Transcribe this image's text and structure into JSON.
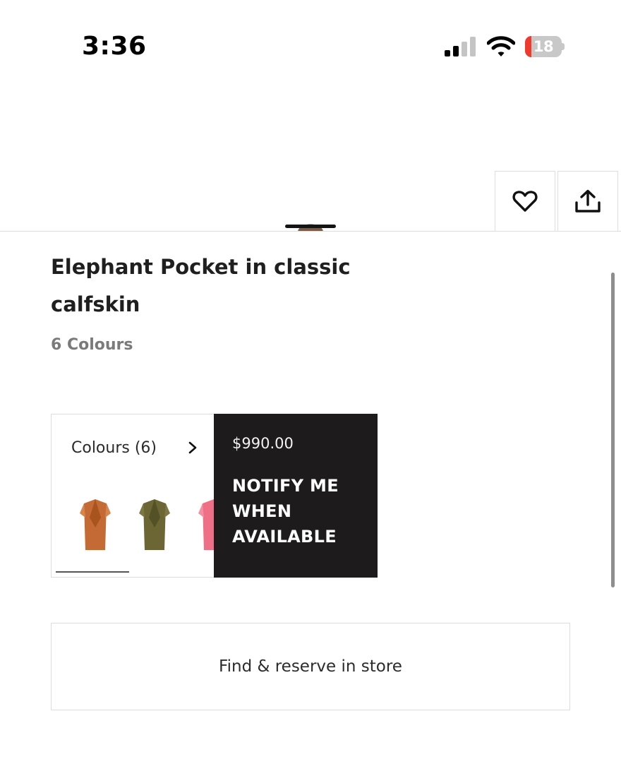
{
  "status_bar": {
    "time": "3:36",
    "battery_percent": "18",
    "battery_level": 0.18,
    "battery_color": "#f03a2e",
    "signal_bars_active": 2,
    "signal_bars_total": 4
  },
  "actions": {
    "wishlist_icon": "heart-icon",
    "share_icon": "share-icon"
  },
  "product": {
    "title": "Elephant Pocket in classic calfskin",
    "colour_count_label": "6 Colours"
  },
  "colours_card": {
    "label": "Colours (6)",
    "swatches": [
      {
        "name": "tan",
        "color": "#c46a34"
      },
      {
        "name": "khaki-green",
        "color": "#6b6634"
      },
      {
        "name": "pink",
        "color": "#ee6f86"
      }
    ]
  },
  "purchase": {
    "price": "$990.00",
    "notify_label": "NOTIFY ME\nWHEN\nAVAILABLE",
    "panel_color": "#1d1b1b"
  },
  "store": {
    "button_label": "Find & reserve in store"
  }
}
